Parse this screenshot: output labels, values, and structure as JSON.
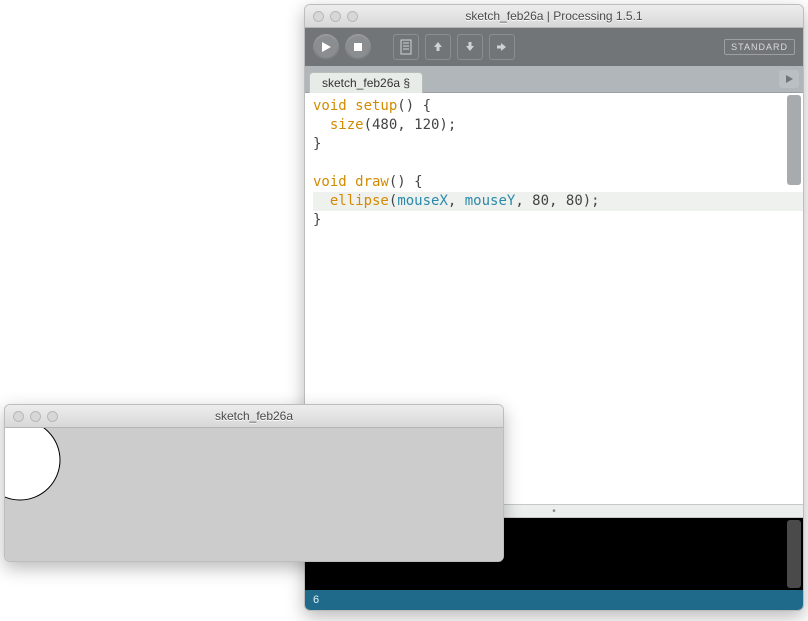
{
  "ide": {
    "title": "sketch_feb26a | Processing 1.5.1",
    "mode_label": "STANDARD",
    "tab_label": "sketch_feb26a §",
    "status_line": "6",
    "code": {
      "l1_void": "void",
      "l1_setup": " setup",
      "l1_tail": "() {",
      "l2_indent": "  ",
      "l2_size": "size",
      "l2_args": "(480, 120);",
      "l3": "}",
      "l4": "",
      "l5_void": "void",
      "l5_draw": " draw",
      "l5_tail": "() {",
      "l6_indent": "  ",
      "l6_ellipse": "ellipse",
      "l6_open": "(",
      "l6_mx": "mouseX",
      "l6_sep1": ", ",
      "l6_my": "mouseY",
      "l6_rest": ", 80, 80);",
      "l7": "}"
    }
  },
  "sketch": {
    "title": "sketch_feb26a"
  },
  "icons": {
    "run": "run-icon",
    "stop": "stop-icon",
    "new": "new-icon",
    "open": "open-icon",
    "save": "save-icon",
    "export": "export-icon"
  }
}
